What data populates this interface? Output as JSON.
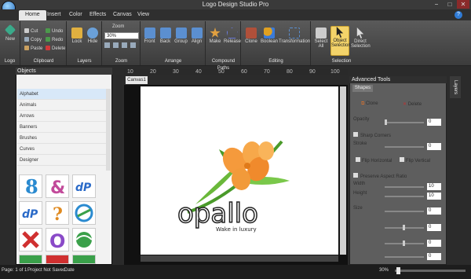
{
  "app": {
    "title": "Logo Design Studio Pro"
  },
  "window_buttons": [
    "−",
    "□",
    "✕"
  ],
  "tabs": [
    "Home",
    "Insert",
    "Color",
    "Effects",
    "Canvas",
    "View"
  ],
  "ribbon": {
    "logo_group": {
      "new_label": "New",
      "label": "Logo"
    },
    "clipboard": {
      "cut": "Cut",
      "copy": "Copy",
      "paste": "Paste",
      "undo": "Undo",
      "redo": "Redo",
      "delete": "Delete",
      "label": "Clipboard"
    },
    "layers": {
      "lock": "Lock",
      "hide": "Hide",
      "label": "Layers"
    },
    "zoom": {
      "title": "Zoom",
      "value": "30%",
      "label": "Zoom"
    },
    "arrange": {
      "front": "Front",
      "back": "Back",
      "group": "Group",
      "align": "Align",
      "label": "Arrange"
    },
    "compound": {
      "make": "Make",
      "release": "Release",
      "label": "Compound Paths"
    },
    "editing": {
      "clone": "Clone",
      "boolean": "Boolean",
      "transformation": "Transformation",
      "label": "Editing"
    },
    "selection": {
      "select_all": "Select All",
      "object_selection": "Object Selection",
      "direct_selection": "Direct Selection",
      "label": "Selection"
    }
  },
  "objects_panel": {
    "title": "Objects",
    "categories": [
      "Alphabet",
      "Animals",
      "Arrows",
      "Banners",
      "Brushes",
      "Curves",
      "Designer"
    ],
    "selected": "Alphabet"
  },
  "canvas": {
    "tab": "Canvas1",
    "ruler_top": [
      "10",
      "20",
      "30",
      "40",
      "50",
      "60",
      "70",
      "80",
      "90",
      "100"
    ],
    "logo_text": "opallo",
    "tagline": "Wake in luxury"
  },
  "advanced_tools": {
    "title": "Advanced Tools",
    "tab": "Shapes",
    "clone": "Clone",
    "delete": "Delete",
    "opacity_label": "Opacity",
    "opacity_value": "0",
    "sharp_corners": "Sharp Corners",
    "stroke_label": "Stroke",
    "stroke_value": "0",
    "flip_h": "Flip Horizontal",
    "flip_v": "Flip Vertical",
    "preserve_aspect": "Preserve Aspect Ratio",
    "width_label": "Width",
    "width_value": "10",
    "height_label": "Height",
    "height_value": "10",
    "rows": [
      {
        "label": "Size",
        "value": "0"
      },
      {
        "label": "",
        "value": "0"
      },
      {
        "label": "",
        "value": "0"
      },
      {
        "label": "",
        "value": "0"
      }
    ]
  },
  "layers_tab": "Layers",
  "status": {
    "page": "Page: 1 of 1",
    "saved": "Project Not Saved",
    "date": "Date",
    "zoom": "30%"
  },
  "colors": {
    "petal": "#f59a3c",
    "leaf": "#4a9a2a",
    "accent": "#f3d36a"
  }
}
